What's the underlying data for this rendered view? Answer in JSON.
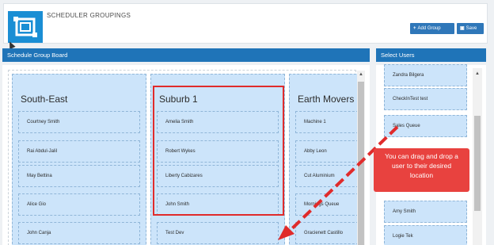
{
  "header": {
    "title": "SCHEDULER GROUPINGS",
    "add_group_label": "Add Group",
    "add_group_icon": "+",
    "save_label": "Save",
    "save_icon": "floppy-disk-icon"
  },
  "board": {
    "title": "Schedule Group Board",
    "groups": [
      {
        "name": "South-East",
        "members": [
          "Courtney Smith",
          "Rai Abdul-Jalil",
          "May Bettina",
          "Alice Gio",
          "John Canja"
        ]
      },
      {
        "name": "Suburb 1",
        "members": [
          "Amelia Smith",
          "Robert Wykes",
          "Liberty Cabizares",
          "John Smith",
          "Test Dev"
        ]
      },
      {
        "name": "Earth Movers",
        "members": [
          "Machine 1",
          "Abby Leon",
          "Cut Aluminium",
          "Mornings Queue",
          "Gracienett Castillo"
        ]
      }
    ]
  },
  "users": {
    "title": "Select Users",
    "items": [
      "Zandra Bilgera",
      "CheckInTest test",
      "Sales Queue",
      "Amy Smith",
      "Logie Tek"
    ]
  },
  "annotation": {
    "text": "You can drag and drop a user to their desired location",
    "color": "#e8423f"
  },
  "colors": {
    "accent": "#1f74b8",
    "group_bg": "#cce4fa",
    "highlight": "#e02b2b"
  }
}
